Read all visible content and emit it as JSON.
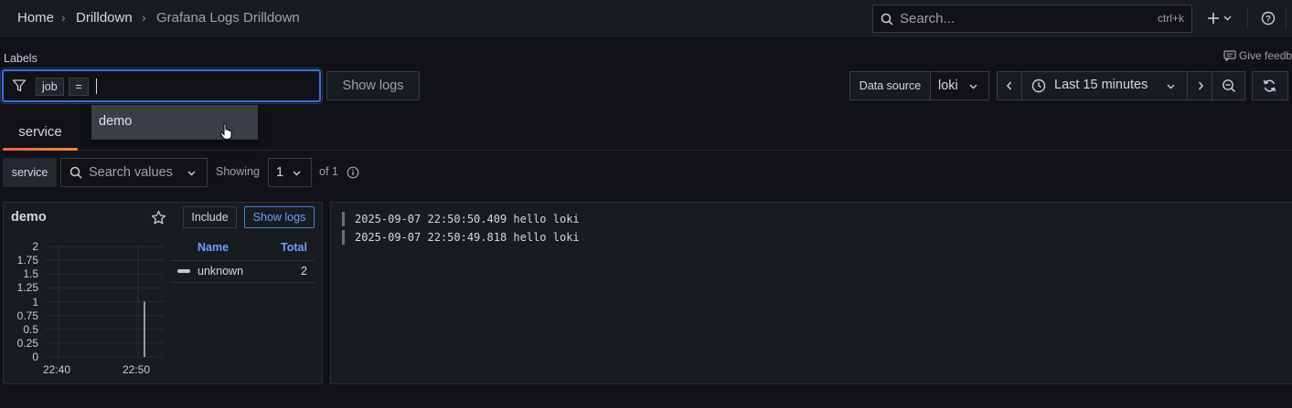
{
  "breadcrumb": {
    "home": "Home",
    "drilldown": "Drilldown",
    "current": "Grafana Logs Drilldown",
    "separator": "›"
  },
  "topbar": {
    "search_placeholder": "Search...",
    "search_shortcut": "ctrl+k",
    "icons": [
      "search-icon",
      "plus-icon",
      "chevron-down-icon",
      "help-icon"
    ]
  },
  "labels": {
    "title": "Labels",
    "filter_key": "job",
    "filter_operator": "=",
    "show_logs_button": "Show logs",
    "give_feedback": "Give feedback",
    "dropdown_options": [
      "demo"
    ]
  },
  "datasource": {
    "label": "Data source",
    "value": "loki"
  },
  "time_range": {
    "value": "Last 15 minutes"
  },
  "tabs": [
    {
      "label": "service",
      "active": true
    }
  ],
  "filters": {
    "tag": "service",
    "search_placeholder": "Search values",
    "showing_label": "Showing",
    "page_value": "1",
    "of_label": "of 1"
  },
  "panel": {
    "title": "demo",
    "include_button": "Include",
    "show_logs_button": "Show logs",
    "legend": {
      "name_header": "Name",
      "total_header": "Total",
      "rows": [
        {
          "name": "unknown",
          "total": "2",
          "color": "#c7c8cf"
        }
      ]
    }
  },
  "chart_data": {
    "type": "bar",
    "y_ticks": [
      "2",
      "1.75",
      "1.5",
      "1.25",
      "1",
      "0.75",
      "0.5",
      "0.25",
      "0"
    ],
    "x_ticks": [
      "22:40",
      "22:50"
    ],
    "ylim": [
      0,
      2
    ],
    "grid": true,
    "series": [
      {
        "name": "unknown",
        "color": "#c7c8cf",
        "points": [
          {
            "x": "22:50",
            "y": 1
          }
        ]
      }
    ]
  },
  "logs": [
    "2025-09-07 22:50:50.409 hello loki",
    "2025-09-07 22:50:49.818 hello loki"
  ],
  "colors": {
    "accent": "#3d71d9",
    "link": "#6e9fff",
    "tab_underline": "#f55f3e"
  }
}
